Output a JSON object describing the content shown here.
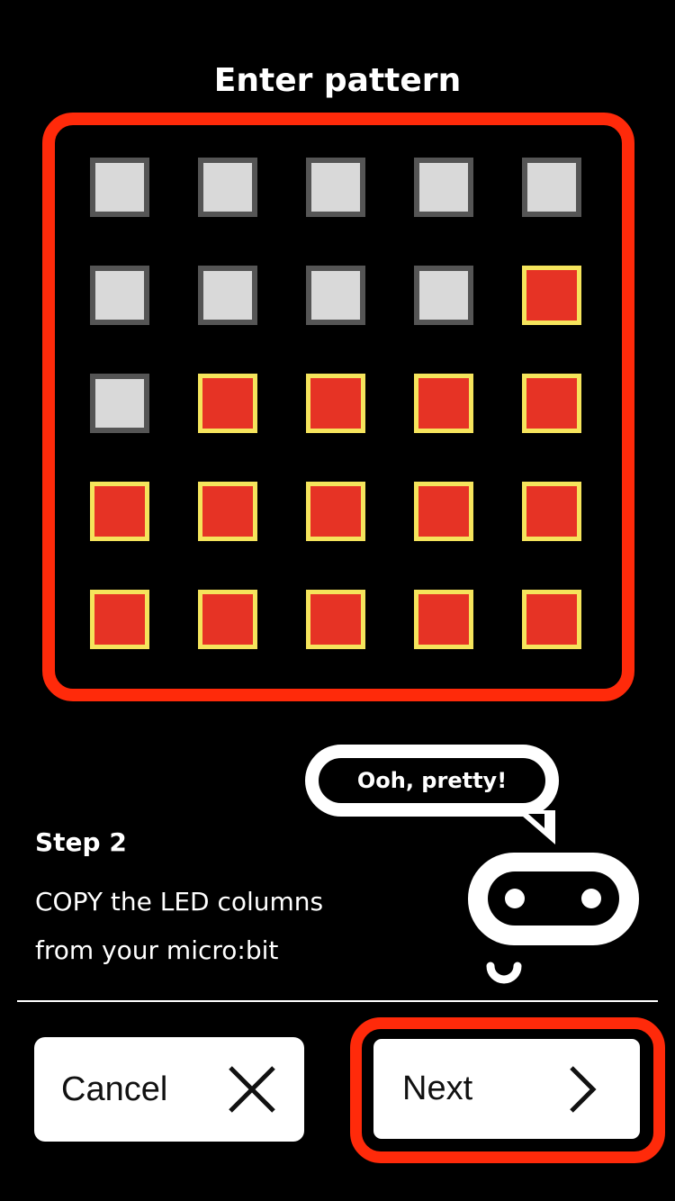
{
  "title": "Enter pattern",
  "grid": {
    "rows": [
      [
        false,
        false,
        false,
        false,
        false
      ],
      [
        false,
        false,
        false,
        false,
        true
      ],
      [
        false,
        true,
        true,
        true,
        true
      ],
      [
        true,
        true,
        true,
        true,
        true
      ],
      [
        true,
        true,
        true,
        true,
        true
      ]
    ],
    "colors": {
      "on_fill": "#e63325",
      "on_border": "#f5e45c",
      "off_fill": "#d9d9d9",
      "off_border": "#555555",
      "highlight": "#ff2a0a"
    }
  },
  "mascot": {
    "speech": "Ooh, pretty!"
  },
  "step": {
    "label": "Step 2",
    "line1": "COPY the LED columns",
    "line2": "from your micro:bit"
  },
  "buttons": {
    "cancel_label": "Cancel",
    "cancel_icon": "close-icon",
    "next_label": "Next",
    "next_icon": "chevron-right-icon"
  }
}
